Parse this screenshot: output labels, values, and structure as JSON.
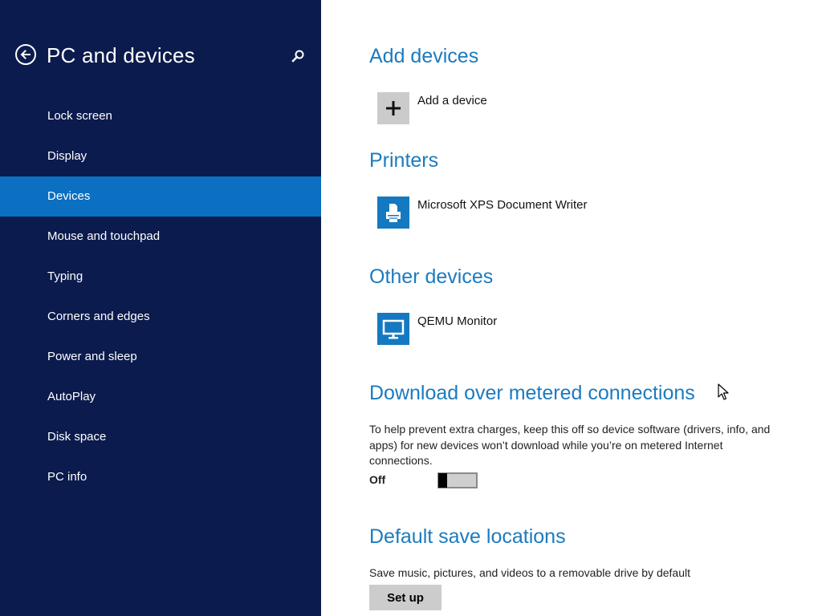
{
  "sidebar": {
    "title": "PC and devices",
    "back_icon": "back-arrow-circle-icon",
    "search_icon": "search-icon",
    "items": [
      {
        "label": "Lock screen",
        "selected": false
      },
      {
        "label": "Display",
        "selected": false
      },
      {
        "label": "Devices",
        "selected": true
      },
      {
        "label": "Mouse and touchpad",
        "selected": false
      },
      {
        "label": "Typing",
        "selected": false
      },
      {
        "label": "Corners and edges",
        "selected": false
      },
      {
        "label": "Power and sleep",
        "selected": false
      },
      {
        "label": "AutoPlay",
        "selected": false
      },
      {
        "label": "Disk space",
        "selected": false
      },
      {
        "label": "PC info",
        "selected": false
      }
    ]
  },
  "main": {
    "add_devices": {
      "title": "Add devices",
      "add_label": "Add a device",
      "icon": "plus-icon"
    },
    "printers": {
      "title": "Printers",
      "items": [
        {
          "label": "Microsoft XPS Document Writer",
          "icon": "printer-icon"
        }
      ]
    },
    "other_devices": {
      "title": "Other devices",
      "items": [
        {
          "label": "QEMU Monitor",
          "icon": "monitor-icon"
        }
      ]
    },
    "metered": {
      "title": "Download over metered connections",
      "description": "To help prevent extra charges, keep this off so device software (drivers, info, and apps) for new devices won’t download while you’re on metered Internet connections.",
      "toggle_label": "Off",
      "toggle_on": false
    },
    "save_locations": {
      "title": "Default save locations",
      "description": "Save music, pictures, and videos to a removable drive by default",
      "button_label": "Set up"
    }
  },
  "colors": {
    "sidebar_bg": "#0b1b4d",
    "selected_bg": "#0b6fc2",
    "accent": "#1c7bbf",
    "tile_blue": "#1479c1",
    "tile_grey": "#cbcbcb"
  }
}
